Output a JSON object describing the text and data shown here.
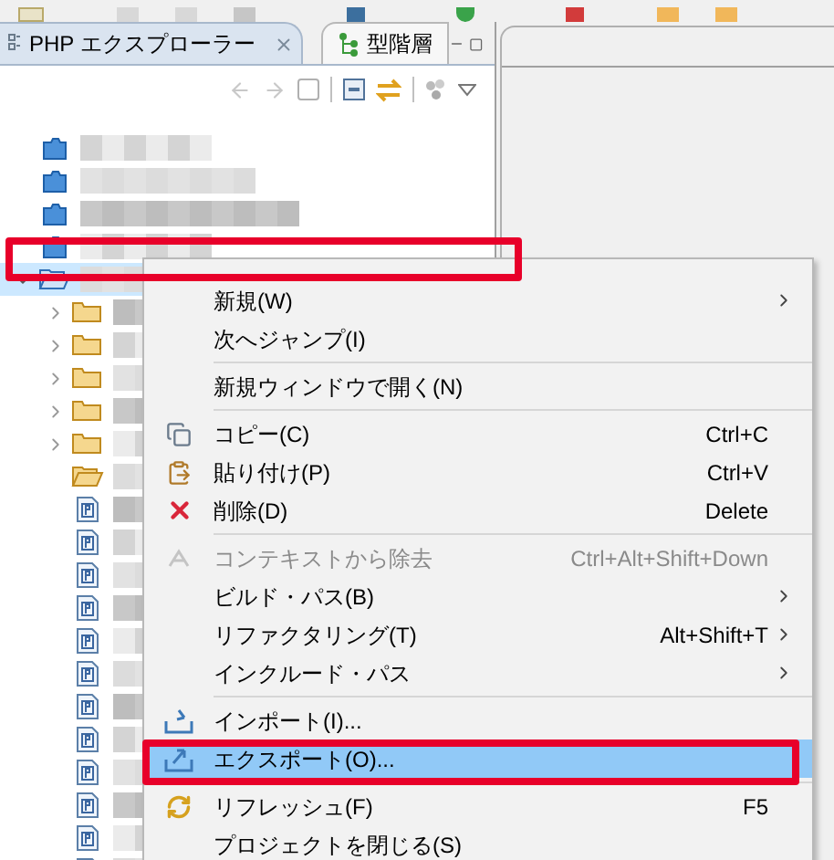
{
  "tabs": [
    {
      "label": "PHP エクスプローラー",
      "selected": true,
      "closable": true
    },
    {
      "label": "型階層",
      "selected": false,
      "closable": false
    }
  ],
  "tree": [
    {
      "kind": "project",
      "selected": false
    },
    {
      "kind": "project",
      "selected": false
    },
    {
      "kind": "project",
      "selected": false
    },
    {
      "kind": "project",
      "selected": false
    },
    {
      "kind": "folder",
      "selected": true,
      "expanded": true,
      "children": [
        {
          "kind": "folder",
          "selected": false,
          "expanded": false
        },
        {
          "kind": "folder",
          "selected": false,
          "expanded": false
        },
        {
          "kind": "folder",
          "selected": false,
          "expanded": false
        },
        {
          "kind": "folder",
          "selected": false,
          "expanded": false
        },
        {
          "kind": "folder",
          "selected": false,
          "expanded": false
        },
        {
          "kind": "empty-folder",
          "selected": false
        },
        {
          "kind": "file",
          "selected": false
        },
        {
          "kind": "file",
          "selected": false
        },
        {
          "kind": "file",
          "selected": false
        },
        {
          "kind": "file",
          "selected": false
        },
        {
          "kind": "file",
          "selected": false
        },
        {
          "kind": "file",
          "selected": false
        },
        {
          "kind": "file",
          "selected": false
        },
        {
          "kind": "file",
          "selected": false
        },
        {
          "kind": "file",
          "selected": false
        },
        {
          "kind": "file",
          "selected": false
        },
        {
          "kind": "file",
          "selected": false
        },
        {
          "kind": "file",
          "selected": false
        }
      ]
    }
  ],
  "menu": [
    {
      "kind": "plain",
      "label": "新規(W)",
      "submenu": true,
      "selected": false,
      "disabled": false
    },
    {
      "kind": "plain",
      "label": "次へジャンプ(I)",
      "submenu": false,
      "selected": false,
      "disabled": false
    },
    {
      "kind": "separator"
    },
    {
      "kind": "plain",
      "label": "新規ウィンドウで開く(N)",
      "submenu": false,
      "selected": false,
      "disabled": false
    },
    {
      "kind": "separator"
    },
    {
      "kind": "copy",
      "label": "コピー(C)",
      "shortcut": "Ctrl+C",
      "submenu": false,
      "selected": false,
      "disabled": false
    },
    {
      "kind": "paste",
      "label": "貼り付け(P)",
      "shortcut": "Ctrl+V",
      "submenu": false,
      "selected": false,
      "disabled": false
    },
    {
      "kind": "delete",
      "label": "削除(D)",
      "shortcut": "Delete",
      "submenu": false,
      "selected": false,
      "disabled": false
    },
    {
      "kind": "separator"
    },
    {
      "kind": "remove",
      "label": "コンテキストから除去",
      "shortcut": "Ctrl+Alt+Shift+Down",
      "submenu": false,
      "selected": false,
      "disabled": true
    },
    {
      "kind": "plain",
      "label": "ビルド・パス(B)",
      "submenu": true,
      "selected": false,
      "disabled": false
    },
    {
      "kind": "plain",
      "label": "リファクタリング(T)",
      "shortcut": "Alt+Shift+T",
      "submenu": true,
      "selected": false,
      "disabled": false
    },
    {
      "kind": "plain",
      "label": "インクルード・パス",
      "submenu": true,
      "selected": false,
      "disabled": false
    },
    {
      "kind": "separator"
    },
    {
      "kind": "import",
      "label": "インポート(I)...",
      "submenu": false,
      "selected": false,
      "disabled": false
    },
    {
      "kind": "export",
      "label": "エクスポート(O)...",
      "submenu": false,
      "selected": true,
      "disabled": false
    },
    {
      "kind": "separator"
    },
    {
      "kind": "refresh",
      "label": "リフレッシュ(F)",
      "shortcut": "F5",
      "submenu": false,
      "selected": false,
      "disabled": false
    },
    {
      "kind": "plain",
      "label": "プロジェクトを閉じる(S)",
      "submenu": false,
      "selected": false,
      "disabled": false
    }
  ]
}
